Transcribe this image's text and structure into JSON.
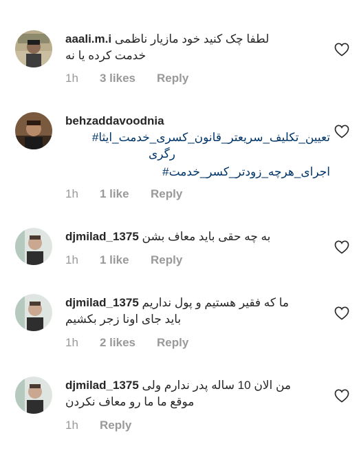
{
  "comments": [
    {
      "username": "aaali.m.i",
      "lines": [
        "لطفا چک کنید خود مازیار ناظمی",
        "خدمت کرده یا نه"
      ],
      "time": "1h",
      "likes": "3 likes",
      "reply": "Reply"
    },
    {
      "username": "behzaddavoodnia",
      "lines": [
        "تعیین_تکلیف_سریعتر_قانون_کسری_خدمت_ایثا#",
        "رگری",
        "اجرای_هرچه_زودتر_کسر_خدمت#"
      ],
      "time": "1h",
      "likes": "1 like",
      "reply": "Reply"
    },
    {
      "username": "djmilad_1375",
      "lines": [
        "به چه حقی باید معاف بشن"
      ],
      "time": "1h",
      "likes": "1 like",
      "reply": "Reply"
    },
    {
      "username": "djmilad_1375",
      "lines": [
        "ما که فقیر هستیم و پول نداریم",
        "باید جای اونا زجر بکشیم"
      ],
      "time": "1h",
      "likes": "2 likes",
      "reply": "Reply"
    },
    {
      "username": "djmilad_1375",
      "lines": [
        "من الان 10 ساله پدر ندارم ولی",
        "موقع ما ما رو معاف نکردن"
      ],
      "time": "1h",
      "likes": "",
      "reply": "Reply"
    }
  ],
  "icons": {
    "like": "heart-outline-icon"
  },
  "colors": {
    "text": "#262626",
    "meta": "#999999",
    "hashtag": "#003569"
  }
}
